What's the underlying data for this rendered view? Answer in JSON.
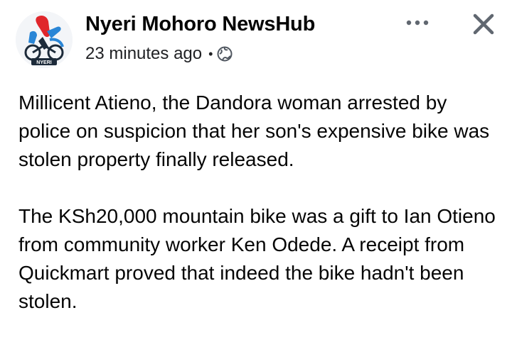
{
  "post": {
    "author_name": "Nyeri Mohoro NewsHub",
    "avatar_label": "NYERI",
    "timestamp": "23 minutes ago",
    "separator": "•",
    "audience_icon": "globe-icon",
    "more_icon": "more-horizontal-icon",
    "close_icon": "close-icon",
    "paragraphs": [
      "Millicent Atieno, the Dandora woman arrested by police on suspicion that her son's expensive bike was stolen property finally released.",
      "The KSh20,000 mountain bike was a gift to Ian Otieno from community worker Ken Odede. A receipt from Quickmart proved that indeed the bike hadn't been stolen."
    ]
  },
  "colors": {
    "text_primary": "#050505",
    "icon_gray": "#606770",
    "logo_red": "#e0262b",
    "logo_blue": "#2a86d6",
    "logo_dark": "#1d2b3a"
  }
}
